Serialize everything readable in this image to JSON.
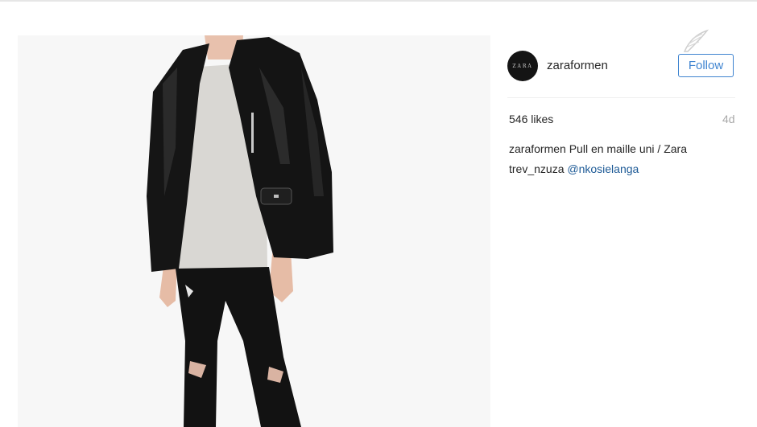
{
  "post": {
    "username": "zaraformen",
    "avatar_text": "ZARA",
    "follow_label": "Follow",
    "likes": "546 likes",
    "time_ago": "4d"
  },
  "comments": [
    {
      "user": "zaraformen",
      "text": "Pull en maille uni / Zara"
    },
    {
      "user": "trev_nzuza",
      "mention": "@nkosielanga"
    }
  ],
  "icons": {
    "watermark": "feather-logo-icon"
  },
  "colors": {
    "accent": "#3f84d0",
    "mention": "#1d5a96",
    "muted": "#a8a8a8",
    "photo_background": "#f6f6f6"
  }
}
